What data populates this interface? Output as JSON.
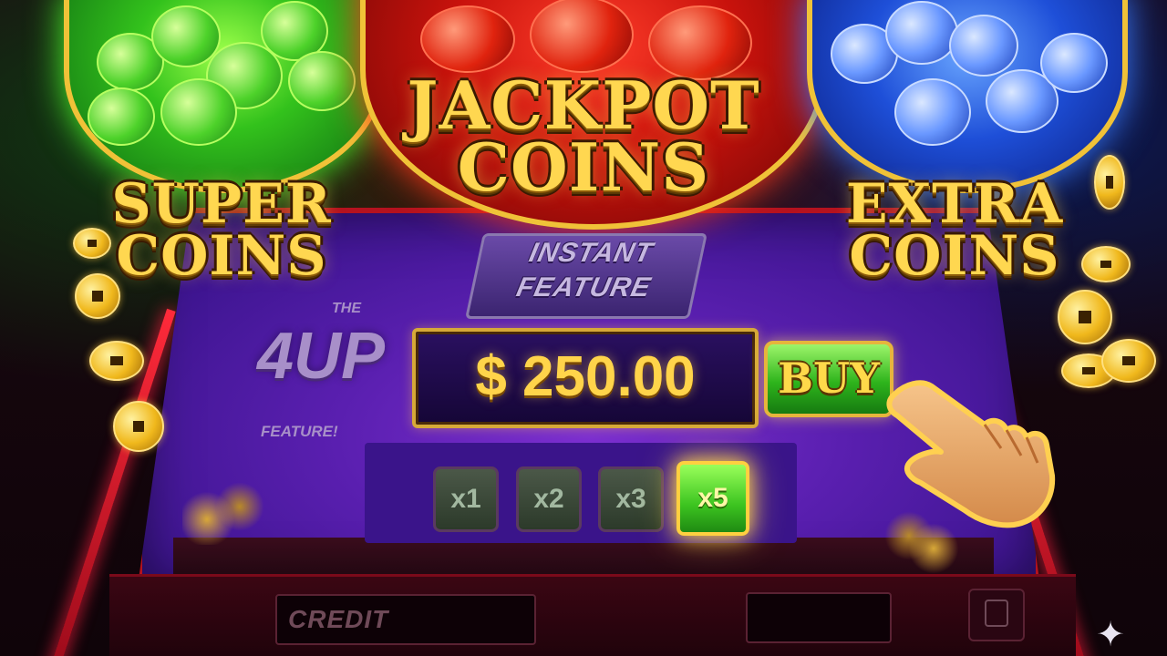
{
  "titles": {
    "left": [
      "SUPER",
      "COINS"
    ],
    "center": [
      "JACKPOT",
      "COINS"
    ],
    "right": [
      "EXTRA",
      "COINS"
    ]
  },
  "instant_feature": [
    "INSTANT",
    "FEATURE"
  ],
  "four_up": {
    "the": "THE",
    "logo": "4UP",
    "feature": "FEATURE!"
  },
  "price": "$ 250.00",
  "buy_label": "BUY",
  "multipliers": [
    {
      "label": "x1",
      "active": false
    },
    {
      "label": "x2",
      "active": false
    },
    {
      "label": "x3",
      "active": false
    },
    {
      "label": "x5",
      "active": true
    }
  ],
  "bottom": {
    "credit_label": "CREDIT"
  },
  "colors": {
    "accent_gold": "#ffd750",
    "screen_purple": "#5a1fb0",
    "buy_green": "#2eb41c",
    "rail_red": "#ff2a3a"
  },
  "icons": {
    "pointer": "hand-pointer-icon",
    "sparkle": "sparkle-icon"
  }
}
